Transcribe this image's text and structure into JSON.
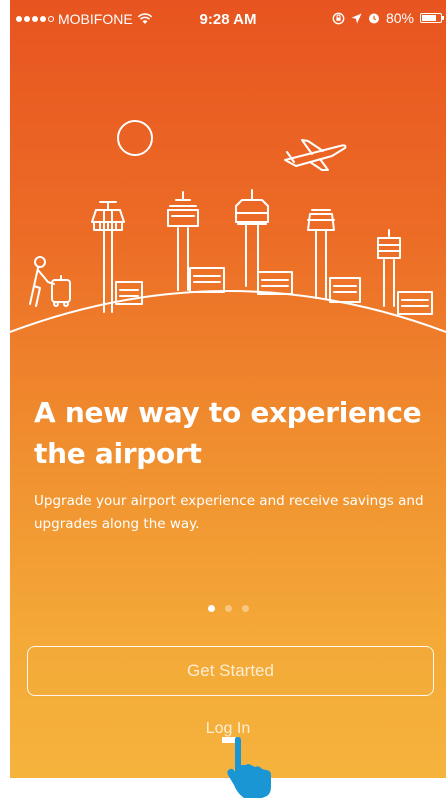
{
  "status_bar": {
    "carrier": "MOBIFONE",
    "time": "9:28 AM",
    "battery": "80%",
    "battery_level": 0.8,
    "signal_bars_filled": 4,
    "signal_bars_total": 5,
    "icons": [
      "wifi-icon",
      "rotation-lock-icon",
      "location-arrow-icon",
      "alarm-icon",
      "battery-icon"
    ]
  },
  "onboarding": {
    "headline": "A new way to experience the airport",
    "subtext": "Upgrade your airport experience and receive savings and upgrades along the way.",
    "page_count": 3,
    "current_page": 1
  },
  "actions": {
    "get_started": "Get Started",
    "login": "Log In"
  },
  "theme": {
    "gradient_top": "#e85420",
    "gradient_bottom": "#f5b33c",
    "text_color": "#ffffff"
  },
  "illustration": {
    "icons": [
      "sun-icon",
      "airplane-icon",
      "control-tower-icon",
      "traveler-with-luggage-icon",
      "terminal-building-icon"
    ]
  },
  "overlay": {
    "icon": "pointing-hand-cursor-icon"
  }
}
